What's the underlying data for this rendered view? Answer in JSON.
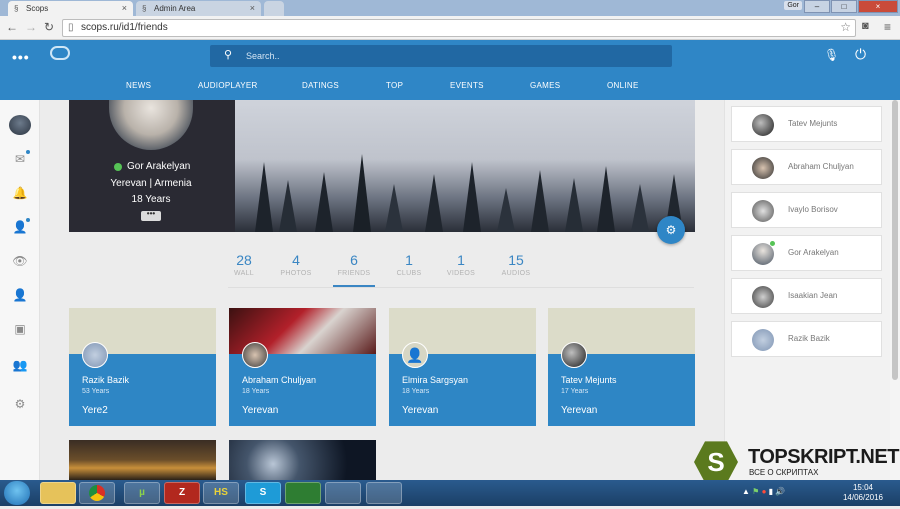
{
  "browser": {
    "tabs": [
      {
        "label": "Scops",
        "active": true
      },
      {
        "label": "Admin Area",
        "active": false
      }
    ],
    "user_label": "Gor",
    "url": "scops.ru/id1/friends"
  },
  "header": {
    "menu_icon": "ellipsis-icon",
    "search_placeholder": "Search..",
    "nav": [
      "NEWS",
      "AUDIOPLAYER",
      "DATINGS",
      "TOP",
      "EVENTS",
      "GAMES",
      "ONLINE"
    ]
  },
  "profile": {
    "name": "Gor Arakelyan",
    "location": "Yerevan | Armenia",
    "age": "18 Years",
    "more_label": "•••"
  },
  "stats": [
    {
      "value": "28",
      "label": "WALL"
    },
    {
      "value": "4",
      "label": "PHOTOS"
    },
    {
      "value": "6",
      "label": "FRIENDS"
    },
    {
      "value": "1",
      "label": "CLUBS"
    },
    {
      "value": "1",
      "label": "VIDEOS"
    },
    {
      "value": "15",
      "label": "AUDIOS"
    }
  ],
  "active_stat": "FRIENDS",
  "friends_cards": [
    {
      "name": "Razik Bazik",
      "age": "53 Years",
      "city": "Yere2"
    },
    {
      "name": "Abraham Chuljyan",
      "age": "18 Years",
      "city": "Yerevan"
    },
    {
      "name": "Elmira Sargsyan",
      "age": "18 Years",
      "city": "Yerevan"
    },
    {
      "name": "Tatev Mejunts",
      "age": "17 Years",
      "city": "Yerevan"
    }
  ],
  "right_friends": [
    {
      "name": "Tatev Mejunts",
      "online": false
    },
    {
      "name": "Abraham Chuljyan",
      "online": false
    },
    {
      "name": "Ivaylo Borisov",
      "online": false
    },
    {
      "name": "Gor Arakelyan",
      "online": true
    },
    {
      "name": "Isaakian Jean",
      "online": false
    },
    {
      "name": "Razik Bazik",
      "online": false
    }
  ],
  "watermark": {
    "letter": "S",
    "title": "TOPSKRIPT.NET",
    "subtitle": "ВСЕ О СКРИПТАХ"
  },
  "taskbar": {
    "apps": [
      "explorer",
      "chrome",
      "utorrent",
      "filezilla",
      "hs",
      "skype",
      "excel",
      "vm",
      "paint"
    ],
    "clock_time": "15:04",
    "clock_date": "14/06/2016"
  },
  "colors": {
    "brand": "#2f86c6",
    "online": "#56c356"
  }
}
